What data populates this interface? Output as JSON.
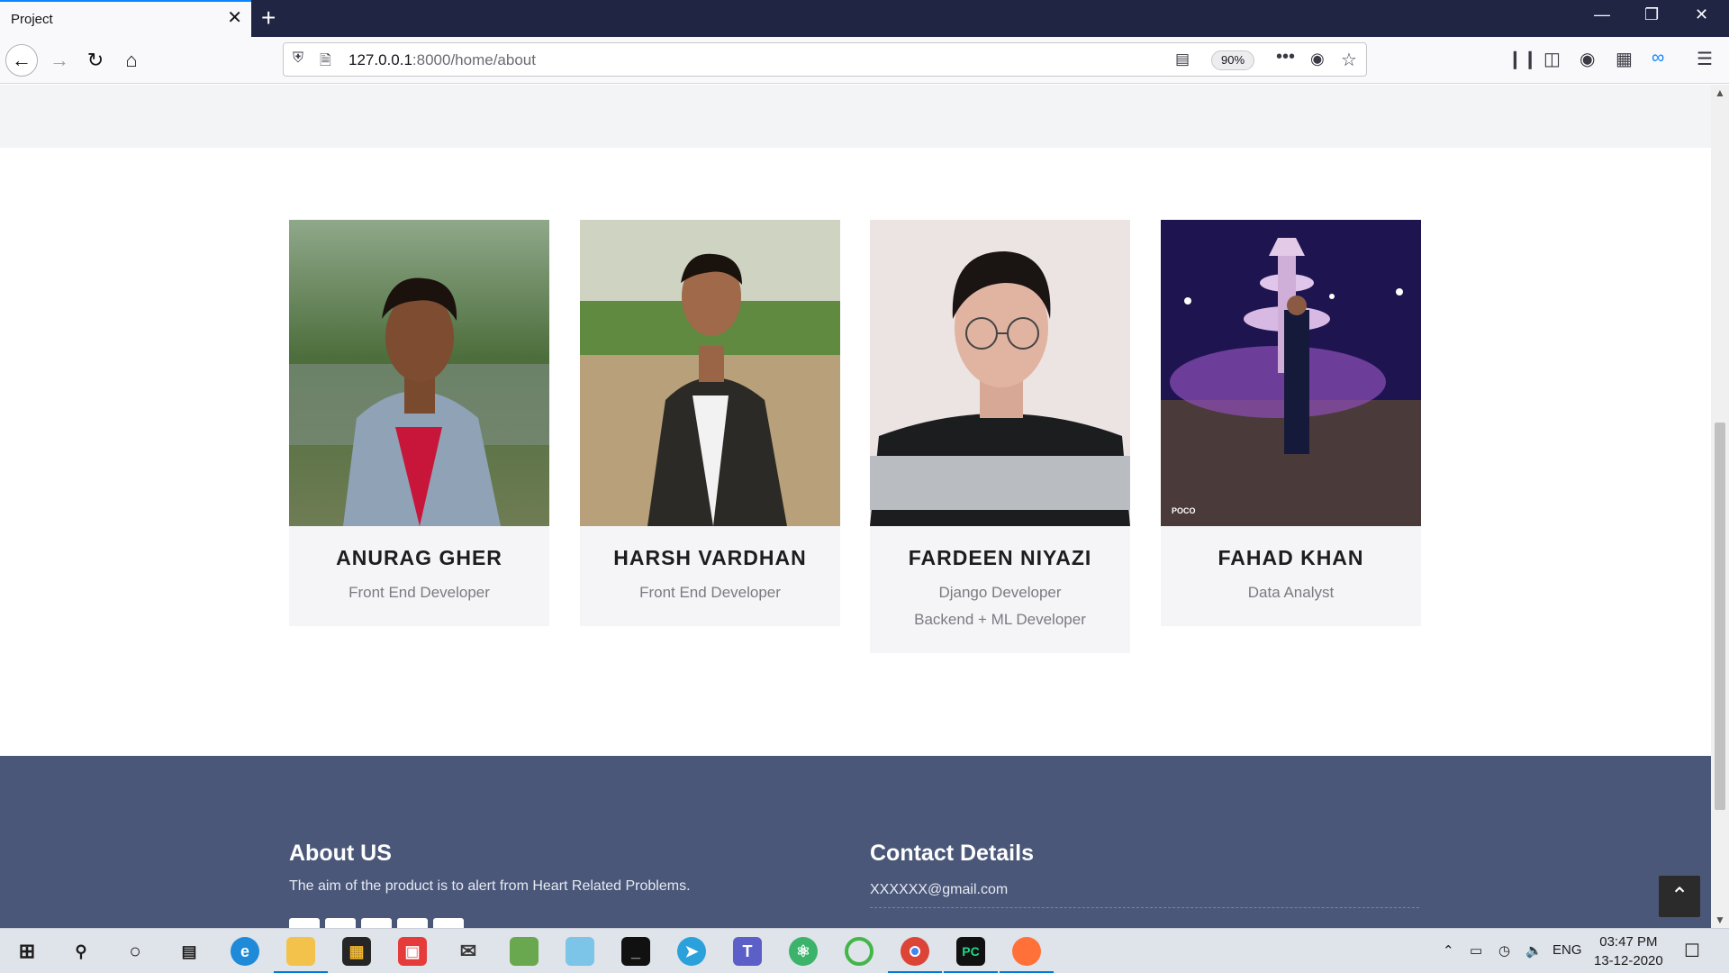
{
  "browser": {
    "tab_title": "Project",
    "tab_close": "✕",
    "new_tab": "+",
    "url_host": "127.0.0.1",
    "url_rest": ":8000/home/about",
    "zoom": "90%",
    "more": "•••"
  },
  "team": [
    {
      "name": "ANURAG GHER",
      "role": "Front End Developer",
      "role2": ""
    },
    {
      "name": "HARSH VARDHAN",
      "role": "Front End Developer",
      "role2": ""
    },
    {
      "name": "FARDEEN NIYAZI",
      "role": "Django Developer",
      "role2": "Backend + ML Developer"
    },
    {
      "name": "FAHAD KHAN",
      "role": "Data Analyst",
      "role2": ""
    }
  ],
  "photo_caption": "POCO",
  "footer": {
    "about_title": "About US",
    "about_text": "The aim of the product is to alert from Heart Related Problems.",
    "contact_title": "Contact Details",
    "contact_email": "XXXXXX@gmail.com"
  },
  "taskbar": {
    "lang": "ENG",
    "time": "03:47 PM",
    "date": "13-12-2020"
  },
  "colors": {
    "footer_bg": "#4a5779",
    "tabbar_bg": "#1f2542",
    "accent": "#0a84ff"
  }
}
